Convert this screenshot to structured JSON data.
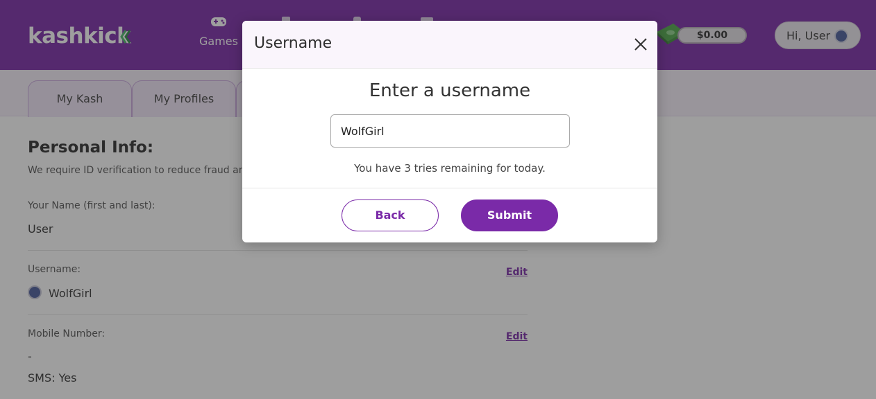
{
  "header": {
    "logo": "kashkick",
    "nav": [
      {
        "label": "Games",
        "icon": "gamepad-icon"
      }
    ],
    "balance": "$0.00",
    "user_greeting": "Hi, User"
  },
  "tabs": [
    {
      "label": "My Kash"
    },
    {
      "label": "My Profiles"
    }
  ],
  "personal_info": {
    "title": "Personal Info:",
    "description": "We require ID verification to reduce fraud an",
    "name_label": "Your Name (first and last):",
    "name_value": "User",
    "username_label": "Username:",
    "username_value": "WolfGirl",
    "mobile_label": "Mobile Number:",
    "mobile_value": "-",
    "sms_value": "SMS: Yes",
    "edit_label": "Edit"
  },
  "modal": {
    "title": "Username",
    "heading": "Enter a username",
    "input_value": "WolfGirl",
    "tries_text": "You have 3 tries remaining for today.",
    "back_label": "Back",
    "submit_label": "Submit"
  },
  "colors": {
    "brand": "#7a2aa8",
    "logo_accent": "#4cb96b"
  }
}
